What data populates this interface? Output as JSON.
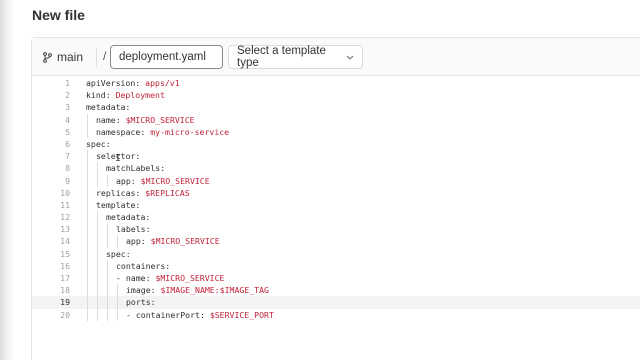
{
  "page": {
    "title": "New file"
  },
  "toolbar": {
    "branch_icon": "git-branch-icon",
    "branch": "main",
    "path_separator": "/",
    "filename": "deployment.yaml",
    "template_placeholder": "Select a template type",
    "dropdown_icon": "chevron-down-icon"
  },
  "editor": {
    "active_line": 19,
    "lines": [
      {
        "n": "1",
        "indent": 0,
        "key": "apiVersion: ",
        "val": "apps/v1"
      },
      {
        "n": "2",
        "indent": 0,
        "key": "kind: ",
        "val": "Deployment"
      },
      {
        "n": "3",
        "indent": 0,
        "key": "metadata:",
        "val": ""
      },
      {
        "n": "4",
        "indent": 1,
        "key": "name: ",
        "val": "$MICRO_SERVICE"
      },
      {
        "n": "5",
        "indent": 1,
        "key": "namespace: ",
        "val": "my-micro-service"
      },
      {
        "n": "6",
        "indent": 0,
        "key": "spec:",
        "val": ""
      },
      {
        "n": "7",
        "indent": 1,
        "key": "selector:",
        "val": ""
      },
      {
        "n": "8",
        "indent": 2,
        "key": "matchLabels:",
        "val": ""
      },
      {
        "n": "9",
        "indent": 3,
        "key": "app: ",
        "val": "$MICRO_SERVICE"
      },
      {
        "n": "10",
        "indent": 1,
        "key": "replicas: ",
        "val": "$REPLICAS"
      },
      {
        "n": "11",
        "indent": 1,
        "key": "template:",
        "val": ""
      },
      {
        "n": "12",
        "indent": 2,
        "key": "metadata:",
        "val": ""
      },
      {
        "n": "13",
        "indent": 3,
        "key": "labels:",
        "val": ""
      },
      {
        "n": "14",
        "indent": 4,
        "key": "app: ",
        "val": "$MICRO_SERVICE"
      },
      {
        "n": "15",
        "indent": 2,
        "key": "spec:",
        "val": ""
      },
      {
        "n": "16",
        "indent": 3,
        "key": "containers:",
        "val": ""
      },
      {
        "n": "17",
        "indent": 3,
        "key": "- name: ",
        "val": "$MICRO_SERVICE"
      },
      {
        "n": "18",
        "indent": 4,
        "key": "image: ",
        "val": "$IMAGE_NAME:$IMAGE_TAG"
      },
      {
        "n": "19",
        "indent": 4,
        "key": "ports:",
        "val": ""
      },
      {
        "n": "20",
        "indent": 4,
        "key": "- containerPort: ",
        "val": "$SERVICE_PORT"
      }
    ]
  }
}
